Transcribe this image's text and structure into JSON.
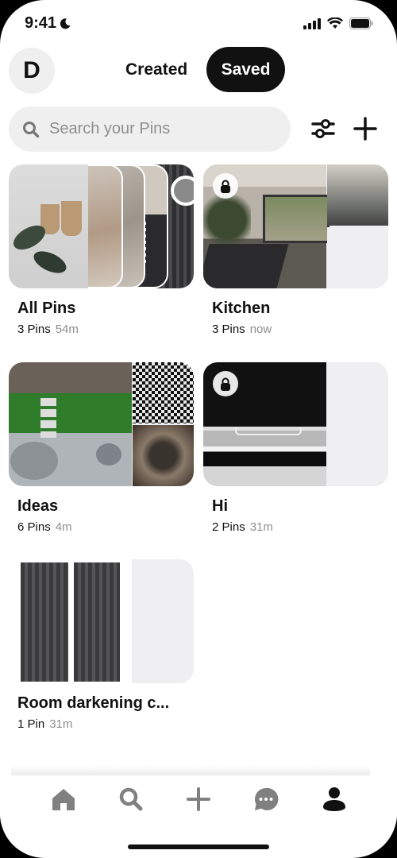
{
  "status_bar": {
    "time": "9:41",
    "moon_icon": "moon-icon",
    "signal_icon": "cellular-signal-icon",
    "wifi_icon": "wifi-icon",
    "battery_icon": "battery-icon"
  },
  "header": {
    "avatar_initial": "D",
    "tabs": [
      {
        "label": "Created",
        "active": false
      },
      {
        "label": "Saved",
        "active": true
      }
    ]
  },
  "search": {
    "placeholder": "Search your Pins",
    "value": "",
    "filter_icon": "sliders-icon",
    "add_icon": "plus-icon"
  },
  "boards": [
    {
      "title": "All Pins",
      "count": "3 Pins",
      "age": "54m",
      "private": false
    },
    {
      "title": "Kitchen",
      "count": "3 Pins",
      "age": "now",
      "private": true
    },
    {
      "title": "Ideas",
      "count": "6 Pins",
      "age": "4m",
      "private": false
    },
    {
      "title": "Hi",
      "count": "2 Pins",
      "age": "31m",
      "private": true
    },
    {
      "title": "Room darkening c...",
      "count": "1 Pin",
      "age": "31m",
      "private": false
    }
  ],
  "bottom_nav": [
    {
      "name": "home",
      "icon": "home-icon",
      "active": false
    },
    {
      "name": "search",
      "icon": "search-icon",
      "active": false
    },
    {
      "name": "create",
      "icon": "plus-icon",
      "active": false
    },
    {
      "name": "messages",
      "icon": "chat-bubble-icon",
      "active": false
    },
    {
      "name": "profile",
      "icon": "person-icon",
      "active": true
    }
  ],
  "colors": {
    "accent": "#111111",
    "muted": "#8e8e8e",
    "inactive_icon": "#767676",
    "surface": "#efefef"
  }
}
